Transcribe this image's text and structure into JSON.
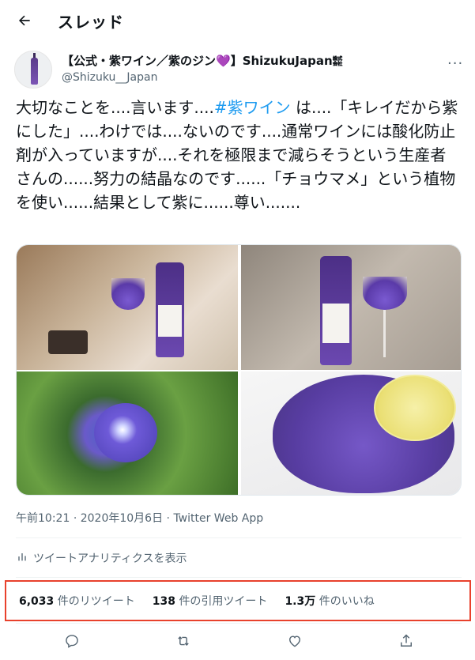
{
  "header": {
    "title": "スレッド",
    "back_icon": "back-arrow-icon"
  },
  "author": {
    "display_name": "【公式・紫ワイン／紫のジン",
    "heart": "💜",
    "display_name_tail": "】ShizukuJapan",
    "corp_mark": "㍿",
    "handle": "@Shizuku__Japan"
  },
  "more_icon": "more-dots-icon",
  "tweet": {
    "text_before": "大切なことを....言います....",
    "hashtag": "#紫ワイン",
    "text_after": " は....「キレイだから紫にした」....わけでは....ないのです....通常ワインには酸化防止剤が入っていますが....それを極限まで減らそうという生産者さんの......努力の結晶なのです......「チョウマメ」という植物を使い......結果として紫に......尊い......."
  },
  "meta": {
    "time": "午前10:21",
    "dot": "·",
    "date": "2020年10月6日",
    "source": "Twitter Web App"
  },
  "analytics": {
    "label": "ツイートアナリティクスを表示",
    "icon": "analytics-bar-icon"
  },
  "stats": [
    {
      "count": "6,033",
      "label": "件のリツイート"
    },
    {
      "count": "138",
      "label": "件の引用ツイート"
    },
    {
      "count": "1.3万",
      "label": "件のいいね"
    }
  ],
  "actions": [
    "reply-icon",
    "retweet-icon",
    "like-icon",
    "share-icon"
  ],
  "colors": {
    "accent": "#1d9bf0",
    "highlight_border": "#e8412c",
    "muted": "#536471",
    "heart": "#a389e6"
  }
}
